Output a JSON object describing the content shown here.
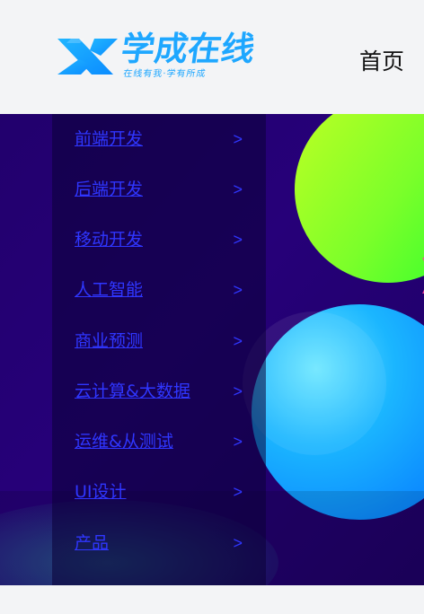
{
  "header": {
    "brand_title": "学成在线",
    "brand_slogan": "在线有我·学有所成",
    "nav": {
      "home_label": "首页"
    },
    "colors": {
      "brand": "#1ea7ff",
      "background": "#f3f4f6"
    }
  },
  "sidebar": {
    "items": [
      {
        "label": "前端开发",
        "chevron": ">"
      },
      {
        "label": "后端开发",
        "chevron": ">"
      },
      {
        "label": "移动开发",
        "chevron": ">"
      },
      {
        "label": "人工智能",
        "chevron": ">"
      },
      {
        "label": "商业预测",
        "chevron": ">"
      },
      {
        "label": "云计算&大数据",
        "chevron": ">"
      },
      {
        "label": "运维&从测试",
        "chevron": ">"
      },
      {
        "label": "UI设计",
        "chevron": ">"
      },
      {
        "label": "产品",
        "chevron": ">"
      }
    ],
    "colors": {
      "link": "#2f36ff",
      "panel": "#0b0037"
    }
  },
  "banner": {
    "colors": {
      "background": "#22006d",
      "green_orb": "#9cff2f",
      "blue_orb": "#23b7ff"
    }
  }
}
